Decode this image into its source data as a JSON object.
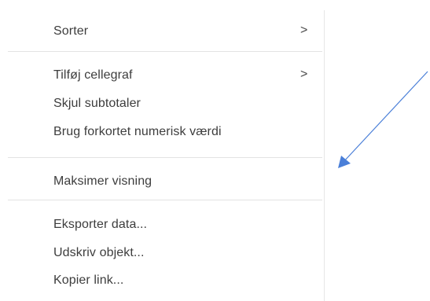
{
  "menu": {
    "sections": [
      {
        "items": [
          {
            "label": "Sorter",
            "submenu": true
          }
        ]
      },
      {
        "items": [
          {
            "label": "Tilføj cellegraf",
            "submenu": true
          },
          {
            "label": "Skjul subtotaler",
            "submenu": false
          },
          {
            "label": "Brug forkortet numerisk værdi",
            "submenu": false
          }
        ]
      },
      {
        "items": [
          {
            "label": "Maksimer visning",
            "submenu": false
          }
        ]
      },
      {
        "items": [
          {
            "label": "Eksporter data...",
            "submenu": false
          },
          {
            "label": "Udskriv objekt...",
            "submenu": false
          },
          {
            "label": "Kopier link...",
            "submenu": false
          }
        ]
      }
    ],
    "chevron_icon": "chevron-right-icon",
    "chevron_glyph": ">"
  },
  "annotation": {
    "arrow_color": "#4a7fd8"
  }
}
